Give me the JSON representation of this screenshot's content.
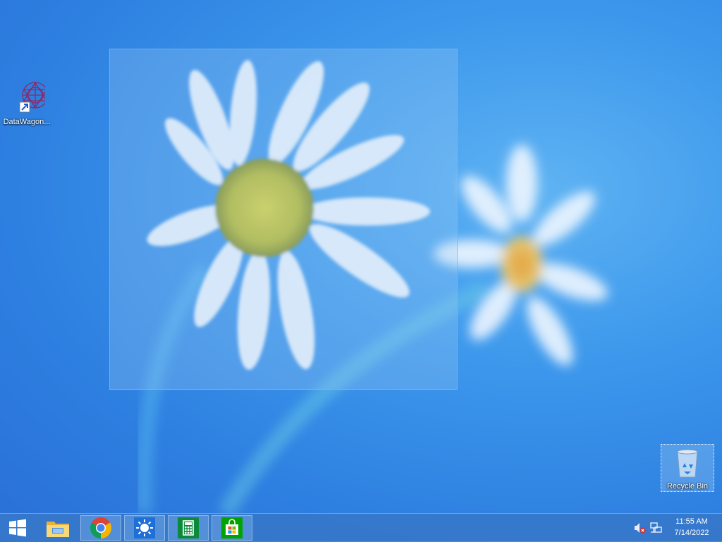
{
  "desktop": {
    "icons": [
      {
        "label": "DataWagon..."
      },
      {
        "label": "Recycle Bin"
      }
    ]
  },
  "taskbar": {
    "pinned": [
      {
        "name": "file-explorer"
      },
      {
        "name": "google-chrome"
      },
      {
        "name": "weather"
      },
      {
        "name": "calculator"
      },
      {
        "name": "store"
      }
    ],
    "clock": {
      "time": "11:55 AM",
      "date": "7/14/2022"
    },
    "tray": [
      "speaker-muted-icon",
      "network-icon"
    ]
  },
  "colors": {
    "desktop_bg": "#2d7fe0",
    "taskbar": "#3778c8",
    "chrome_red": "#db4437",
    "chrome_green": "#0f9d58",
    "chrome_yellow": "#f4b400",
    "chrome_blue": "#4285f4",
    "store_green": "#00a300"
  }
}
